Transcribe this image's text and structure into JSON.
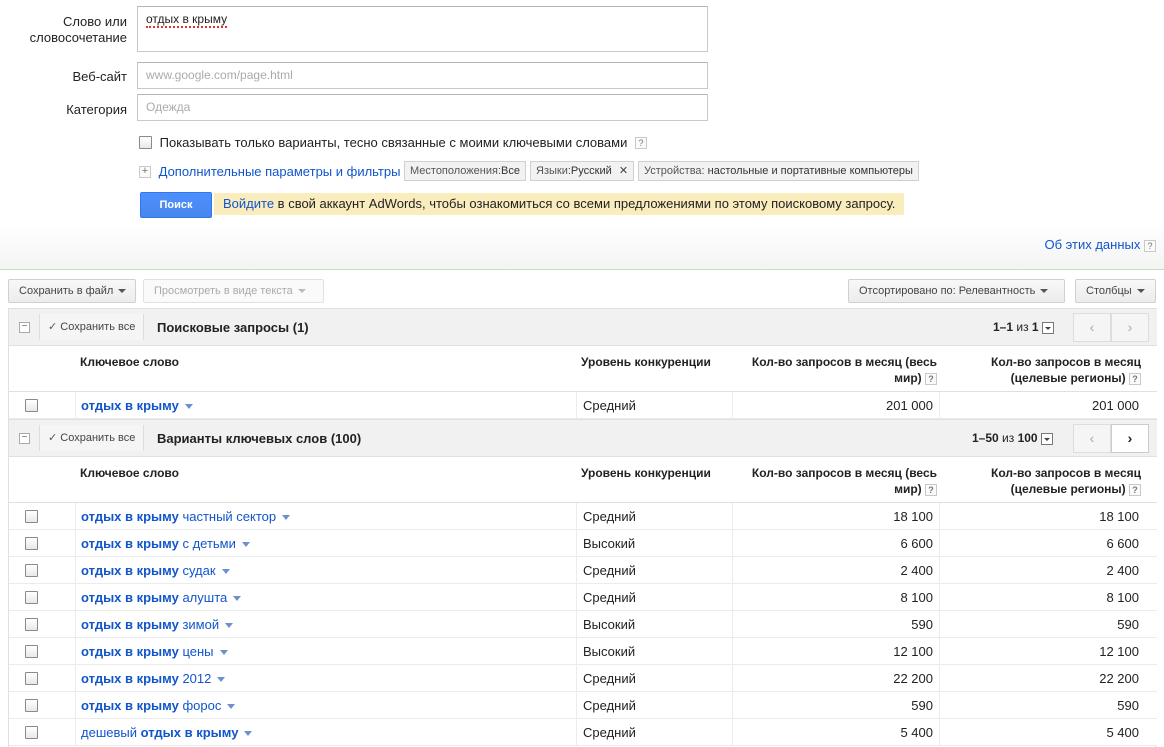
{
  "form": {
    "keyword_label": "Слово или словосочетание",
    "keyword_value": "отдых в крыму",
    "website_label": "Веб-сайт",
    "website_placeholder": "www.google.com/page.html",
    "category_label": "Категория",
    "category_placeholder": "Одежда",
    "only_close_label": "Показывать только варианты, тесно связанные с моими ключевыми словами",
    "help_glyph": "?",
    "expand_glyph": "+",
    "advanced_link": "Дополнительные параметры и фильтры",
    "filters": {
      "location_key": "Местоположения:",
      "location_val": "Все",
      "language_key": "Языки:",
      "language_val": "Русский",
      "remove_glyph": "✕",
      "devices_key": "Устройства:",
      "devices_val": "настольные и портативные компьютеры"
    },
    "search_button": "Поиск",
    "notice_link": "Войдите",
    "notice_text": " в свой аккаунт AdWords, чтобы ознакомиться со всеми предложениями по этому поисковому запросу."
  },
  "about_link": "Об этих данных",
  "toolbar": {
    "save_file": "Сохранить в файл",
    "view_text": "Просмотреть в виде текста",
    "sorted_by": "Отсортировано по: Релевантность",
    "columns": "Столбцы"
  },
  "columns": {
    "keyword": "Ключевое слово",
    "competition": "Уровень конкуренции",
    "global_line1": "Кол-во запросов в месяц (весь",
    "global_line2": "мир)",
    "local_line1": "Кол-во запросов в месяц",
    "local_line2": "(целевые регионы)"
  },
  "section1": {
    "collapse_glyph": "−",
    "check_glyph": "✓",
    "save_all": "Сохранить все",
    "title": "Поисковые запросы (1)",
    "range": "1–1",
    "of": " из ",
    "total": "1",
    "prev_glyph": "‹",
    "next_glyph": "›",
    "rows": [
      {
        "bold": "отдых в крыму",
        "rest": "",
        "competition": "Средний",
        "global": "201 000",
        "local": "201 000"
      }
    ]
  },
  "section2": {
    "collapse_glyph": "−",
    "check_glyph": "✓",
    "save_all": "Сохранить все",
    "title": "Варианты ключевых слов (100)",
    "range": "1–50",
    "of": " из ",
    "total": "100",
    "prev_glyph": "‹",
    "next_glyph": "›",
    "rows": [
      {
        "pre": "",
        "bold": "отдых в крыму",
        "rest": " частный сектор",
        "competition": "Средний",
        "global": "18 100",
        "local": "18 100"
      },
      {
        "pre": "",
        "bold": "отдых в крыму",
        "rest": " с детьми",
        "competition": "Высокий",
        "global": "6 600",
        "local": "6 600"
      },
      {
        "pre": "",
        "bold": "отдых в крыму",
        "rest": " судак",
        "competition": "Средний",
        "global": "2 400",
        "local": "2 400"
      },
      {
        "pre": "",
        "bold": "отдых в крыму",
        "rest": " алушта",
        "competition": "Средний",
        "global": "8 100",
        "local": "8 100"
      },
      {
        "pre": "",
        "bold": "отдых в крыму",
        "rest": " зимой",
        "competition": "Высокий",
        "global": "590",
        "local": "590"
      },
      {
        "pre": "",
        "bold": "отдых в крыму",
        "rest": " цены",
        "competition": "Высокий",
        "global": "12 100",
        "local": "12 100"
      },
      {
        "pre": "",
        "bold": "отдых в крыму",
        "rest": " 2012",
        "competition": "Средний",
        "global": "22 200",
        "local": "22 200"
      },
      {
        "pre": "",
        "bold": "отдых в крыму",
        "rest": " форос",
        "competition": "Средний",
        "global": "590",
        "local": "590"
      },
      {
        "pre": "дешевый ",
        "bold": "отдых в крыму",
        "rest": "",
        "competition": "Средний",
        "global": "5 400",
        "local": "5 400"
      }
    ]
  },
  "colors": {
    "link": "#1155cc",
    "notice_bg": "#f9edbe",
    "primary_button": "#4d90fe"
  }
}
